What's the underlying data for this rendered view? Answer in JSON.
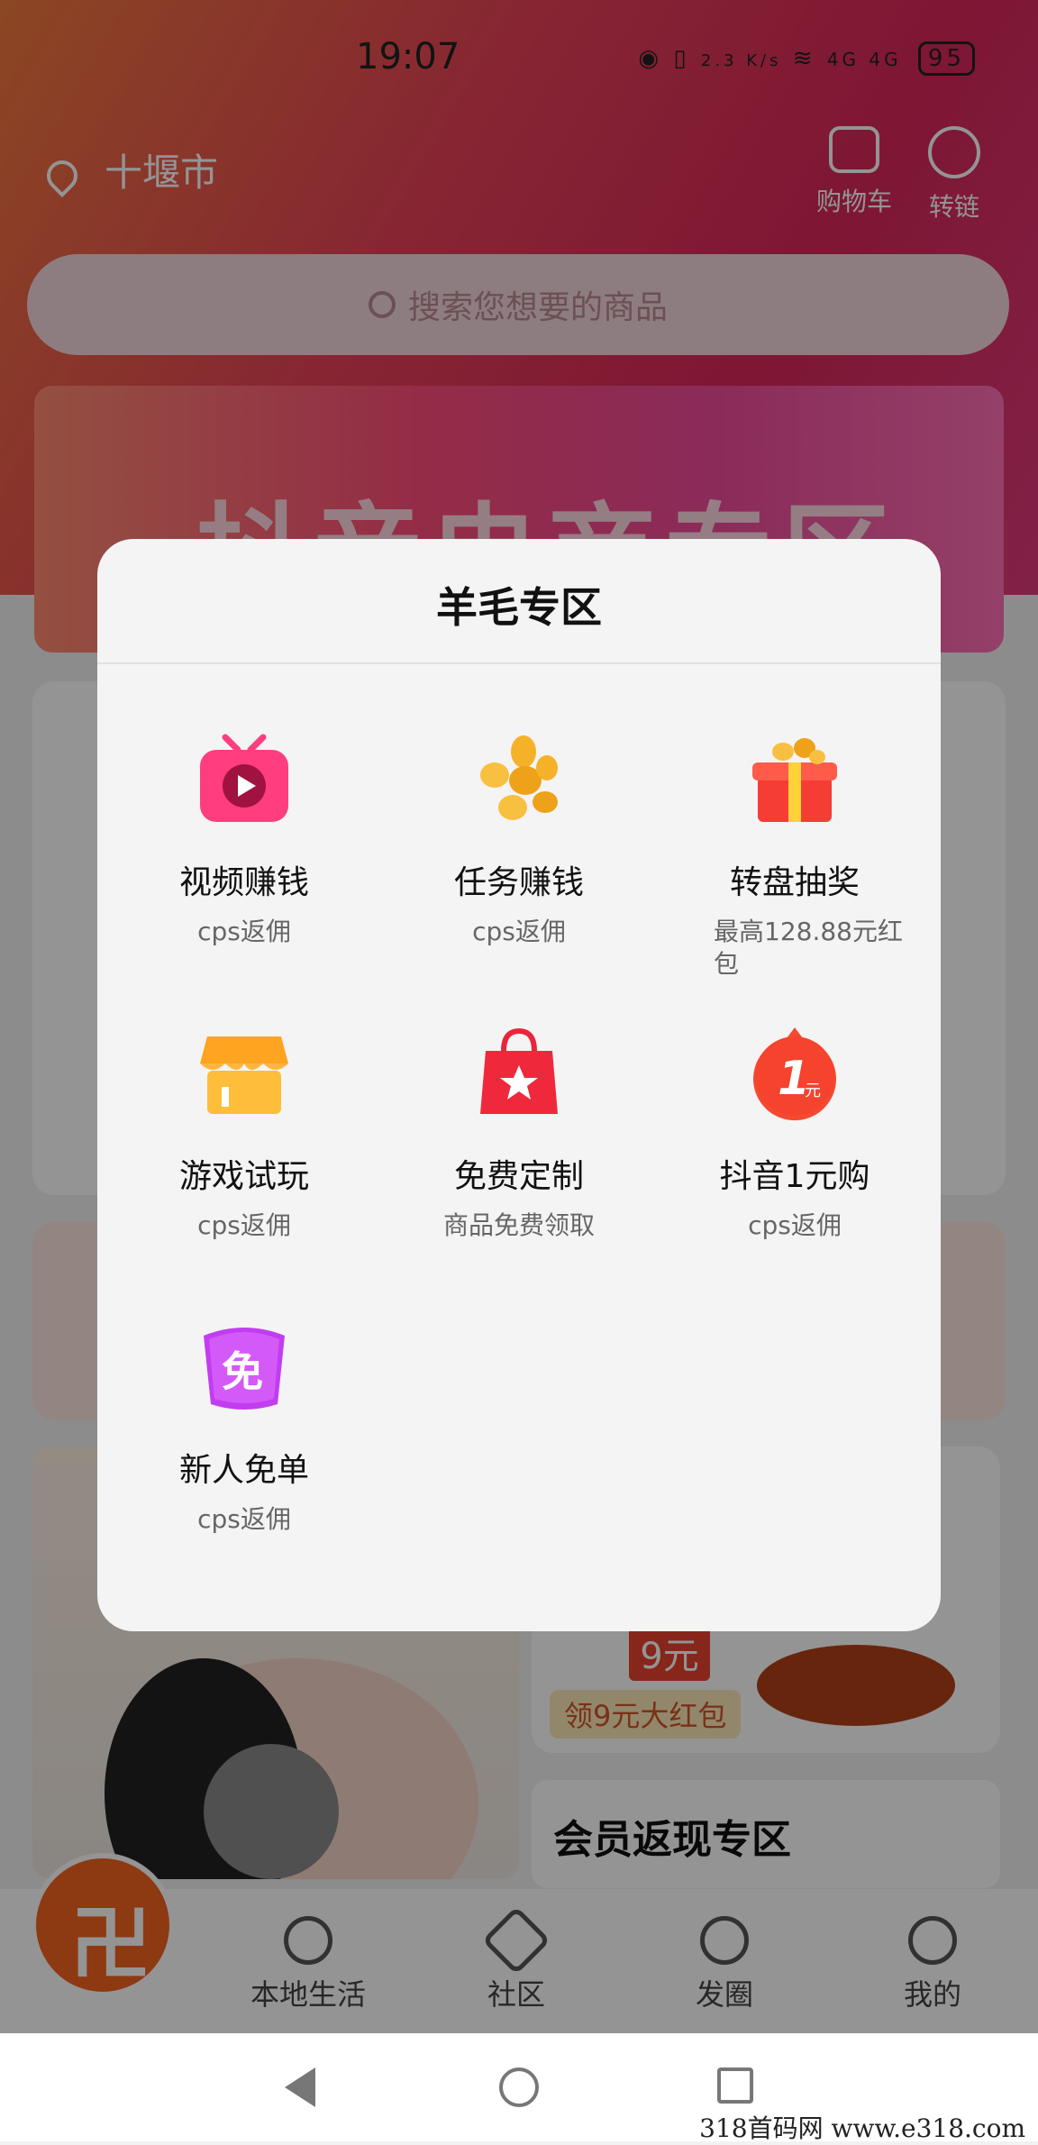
{
  "status_bar": {
    "time": "19:07",
    "net_speed": "2.3 K/s",
    "signal": "4G 4G",
    "battery": "95"
  },
  "header": {
    "city": "十堰市",
    "cart_label": "购物车",
    "link_label": "转链",
    "search_placeholder": "搜索您想要的商品"
  },
  "banner": {
    "text": "抖音电商专区"
  },
  "background": {
    "promo_9_label": "领9元大红包",
    "promo_9_value": "9元",
    "member_section": "会员返现专区"
  },
  "modal": {
    "title": "羊毛专区",
    "items": [
      {
        "name": "视频赚钱",
        "sub": "cps返佣",
        "icon": "tv-play-icon"
      },
      {
        "name": "任务赚钱",
        "sub": "cps返佣",
        "icon": "coins-icon"
      },
      {
        "name": "转盘抽奖",
        "sub": "最高128.88元红包",
        "icon": "gift-box-icon"
      },
      {
        "name": "游戏试玩",
        "sub": "cps返佣",
        "icon": "shop-icon"
      },
      {
        "name": "免费定制",
        "sub": "商品免费领取",
        "icon": "shopping-bag-icon"
      },
      {
        "name": "抖音1元购",
        "sub": "cps返佣",
        "icon": "one-yuan-icon"
      },
      {
        "name": "新人免单",
        "sub": "cps返佣",
        "icon": "free-badge-icon"
      }
    ]
  },
  "bottom_nav": {
    "tabs": [
      {
        "label": "本地生活",
        "icon": "flame-icon"
      },
      {
        "label": "社区",
        "icon": "heart-diamond-icon"
      },
      {
        "label": "发圈",
        "icon": "circle-arrow-icon"
      },
      {
        "label": "我的",
        "icon": "person-icon"
      }
    ]
  },
  "watermark": "318首码网   www.e318.com",
  "colors": {
    "accent": "#e8315a",
    "modal_bg": "#f4f4f4"
  }
}
